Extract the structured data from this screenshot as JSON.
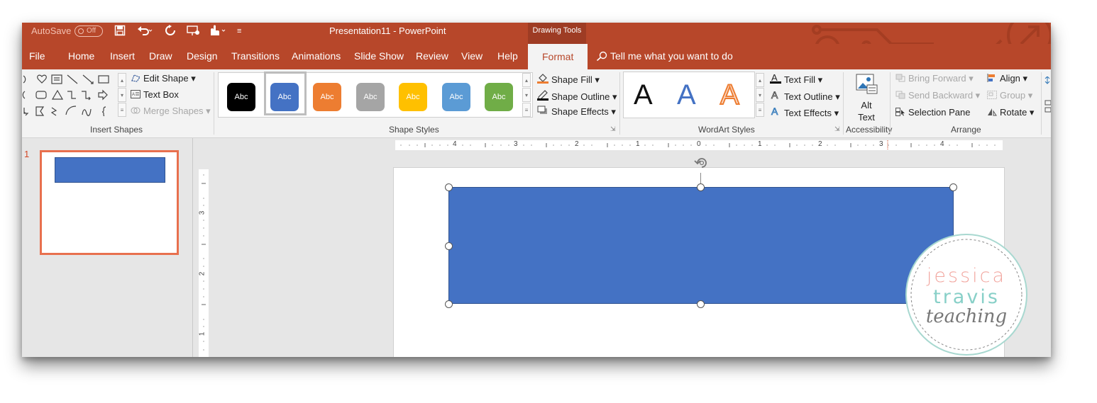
{
  "titlebar": {
    "autosave_label": "AutoSave",
    "autosave_state": "Off",
    "title": "Presentation11  -  PowerPoint",
    "context_group": "Drawing Tools"
  },
  "tabs": [
    "File",
    "Home",
    "Insert",
    "Draw",
    "Design",
    "Transitions",
    "Animations",
    "Slide Show",
    "Review",
    "View",
    "Help"
  ],
  "active_tab": "Format",
  "tell_me": "Tell me what you want to do",
  "insert_shapes": {
    "edit_shape": "Edit Shape",
    "text_box": "Text Box",
    "merge_shapes": "Merge Shapes",
    "group_label": "Insert Shapes"
  },
  "shape_styles": {
    "swatch_text": "Abc",
    "swatches": [
      {
        "color": "#000000"
      },
      {
        "color": "#4472c4",
        "selected": true
      },
      {
        "color": "#ed7d31"
      },
      {
        "color": "#a5a5a5"
      },
      {
        "color": "#ffc000"
      },
      {
        "color": "#5b9bd5"
      },
      {
        "color": "#70ad47"
      }
    ],
    "shape_fill": "Shape Fill",
    "shape_outline": "Shape Outline",
    "shape_effects": "Shape Effects",
    "group_label": "Shape Styles"
  },
  "wordart": {
    "letter": "A",
    "text_fill": "Text Fill",
    "text_outline": "Text Outline",
    "text_effects": "Text Effects",
    "group_label": "WordArt Styles"
  },
  "accessibility": {
    "alt_text_line1": "Alt",
    "alt_text_line2": "Text",
    "group_label": "Accessibility"
  },
  "arrange": {
    "bring_forward": "Bring Forward",
    "send_backward": "Send Backward",
    "selection_pane": "Selection Pane",
    "align": "Align",
    "group": "Group",
    "rotate": "Rotate",
    "group_label": "Arrange"
  },
  "slides": [
    {
      "number": "1"
    }
  ],
  "ruler": {
    "horizontal": [
      "4",
      "3",
      "2",
      "1",
      "0",
      "1",
      "2",
      "3",
      "4"
    ],
    "vertical": [
      "3",
      "2",
      "1"
    ]
  },
  "watermark": {
    "line1": "jessica",
    "line2": "travis",
    "line3": "teaching"
  },
  "colors": {
    "ribbon_accent": "#b7472a",
    "shape_fill": "#4472c4",
    "thumbnail_border": "#e8704e"
  }
}
